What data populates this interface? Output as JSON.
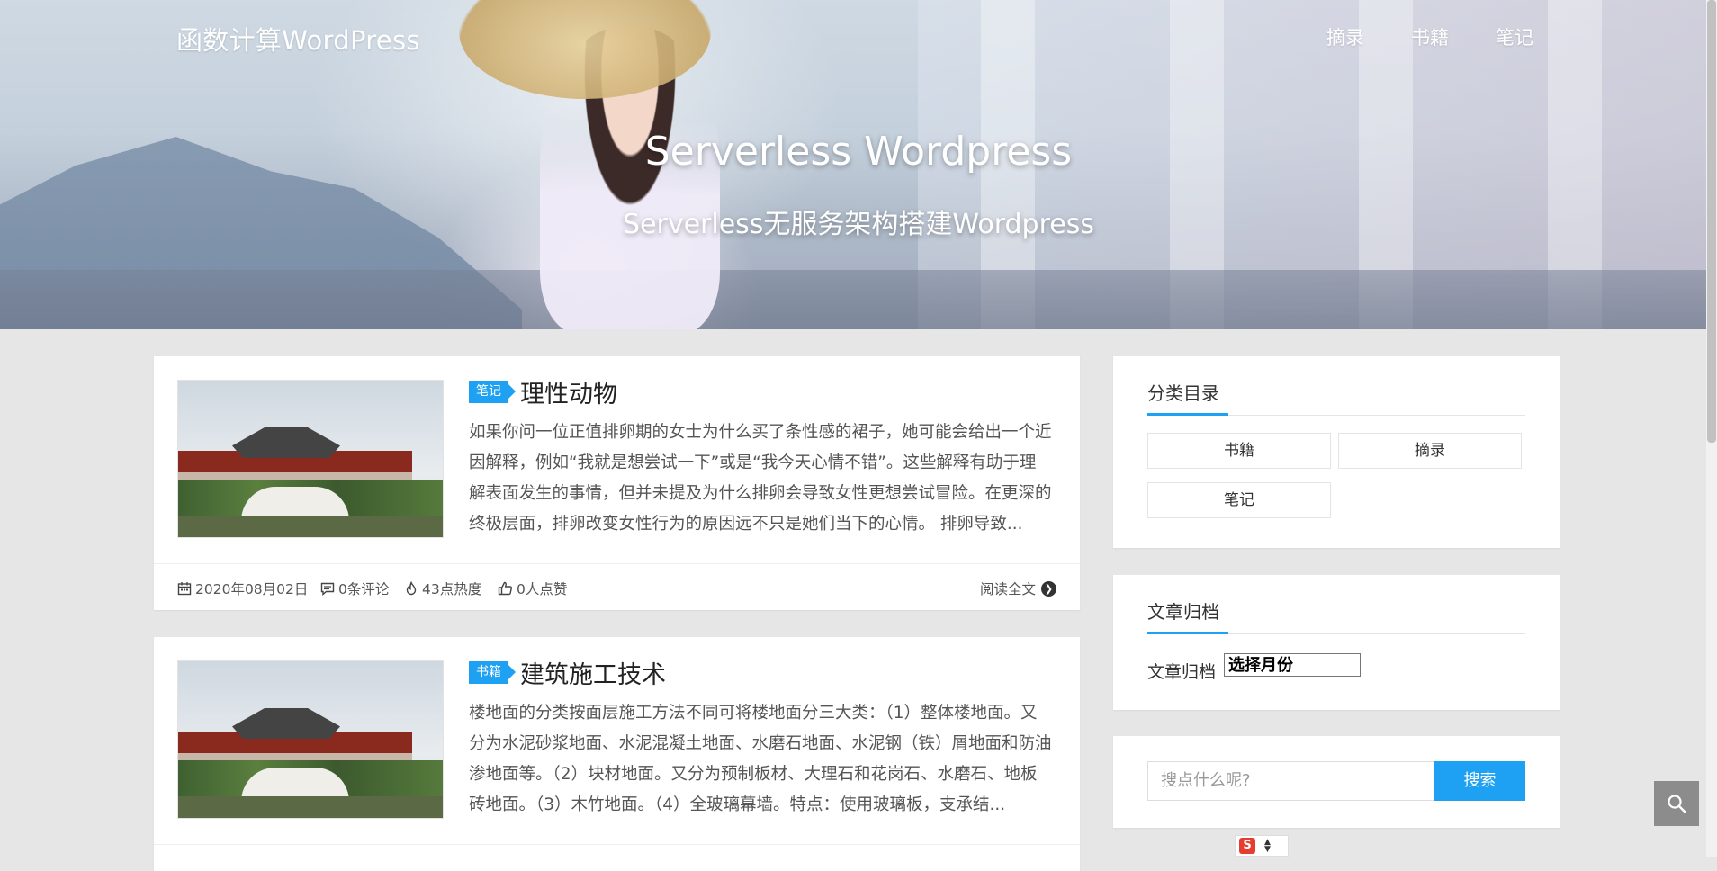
{
  "header": {
    "site_title": "函数计算WordPress",
    "nav": [
      {
        "label": "摘录"
      },
      {
        "label": "书籍"
      },
      {
        "label": "笔记"
      }
    ],
    "hero_title": "Serverless Wordpress",
    "hero_subtitle": "Serverless无服务架构搭建Wordpress"
  },
  "posts": [
    {
      "category": "笔记",
      "title": "理性动物",
      "excerpt": "如果你问一位正值排卵期的女士为什么买了条性感的裙子，她可能会给出一个近因解释，例如“我就是想尝试一下”或是“我今天心情不错”。这些解释有助于理解表面发生的事情，但并未提及为什么排卵会导致女性更想尝试冒险。在更深的终极层面，排卵改变女性行为的原因远不只是她们当下的心情。 排卵导致...",
      "date": "2020年08月02日",
      "comments": "0条评论",
      "heat": "43点热度",
      "likes": "0人点赞",
      "read_more": "阅读全文"
    },
    {
      "category": "书籍",
      "title": "建筑施工技术",
      "excerpt": "楼地面的分类按面层施工方法不同可将楼地面分三大类：（1）整体楼地面。又分为水泥砂浆地面、水泥混凝土地面、水磨石地面、水泥钢（铁）屑地面和防油渗地面等。（2）块材地面。又分为预制板材、大理石和花岗石、水磨石、地板砖地面。（3）木竹地面。（4）全玻璃幕墙。特点：使用玻璃板，支承结..."
    }
  ],
  "sidebar": {
    "categories": {
      "title": "分类目录",
      "items": [
        {
          "label": "书籍"
        },
        {
          "label": "摘录"
        },
        {
          "label": "笔记"
        }
      ]
    },
    "archive": {
      "title": "文章归档",
      "label": "文章归档",
      "select_value": "选择月份"
    },
    "search": {
      "placeholder": "搜点什么呢?",
      "button": "搜索"
    }
  },
  "ime": {
    "logo": "S"
  },
  "colors": {
    "accent": "#1ea1f2",
    "float_button": "#8c8c8c"
  }
}
